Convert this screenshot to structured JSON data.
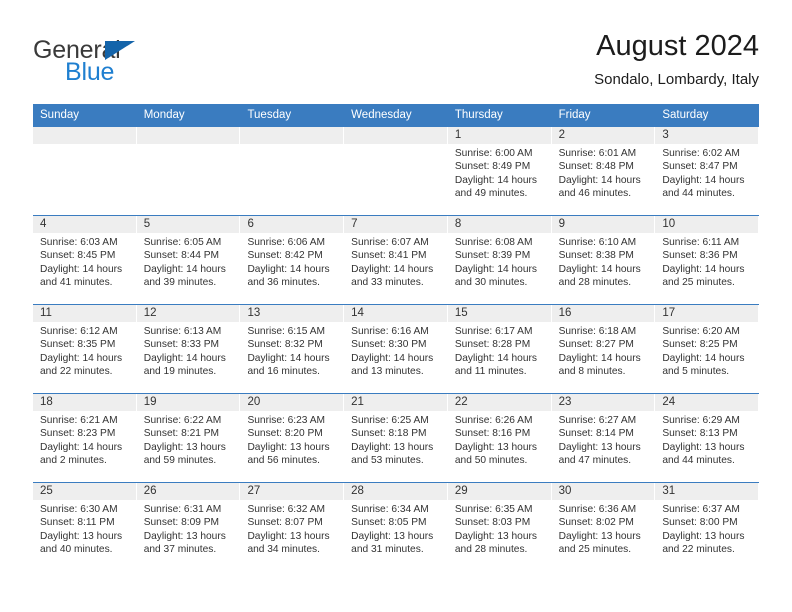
{
  "brand": {
    "name_part1": "General",
    "name_part2": "Blue",
    "triangle_color": "#1464aa",
    "blue_color": "#1f7fd0"
  },
  "header": {
    "title": "August 2024",
    "subtitle": "Sondalo, Lombardy, Italy"
  },
  "theme": {
    "header_bar_color": "#3a7cc0",
    "day_band_color": "#eeeeee",
    "text_color": "#333333"
  },
  "weekdays": [
    "Sunday",
    "Monday",
    "Tuesday",
    "Wednesday",
    "Thursday",
    "Friday",
    "Saturday"
  ],
  "labels": {
    "sunrise_prefix": "Sunrise: ",
    "sunset_prefix": "Sunset: ",
    "daylight_prefix": "Daylight: "
  },
  "weeks": [
    [
      {
        "day": "",
        "empty": true
      },
      {
        "day": "",
        "empty": true
      },
      {
        "day": "",
        "empty": true
      },
      {
        "day": "",
        "empty": true
      },
      {
        "day": "1",
        "sunrise": "Sunrise: 6:00 AM",
        "sunset": "Sunset: 8:49 PM",
        "daylight_l1": "Daylight: 14 hours",
        "daylight_l2": "and 49 minutes."
      },
      {
        "day": "2",
        "sunrise": "Sunrise: 6:01 AM",
        "sunset": "Sunset: 8:48 PM",
        "daylight_l1": "Daylight: 14 hours",
        "daylight_l2": "and 46 minutes."
      },
      {
        "day": "3",
        "sunrise": "Sunrise: 6:02 AM",
        "sunset": "Sunset: 8:47 PM",
        "daylight_l1": "Daylight: 14 hours",
        "daylight_l2": "and 44 minutes."
      }
    ],
    [
      {
        "day": "4",
        "sunrise": "Sunrise: 6:03 AM",
        "sunset": "Sunset: 8:45 PM",
        "daylight_l1": "Daylight: 14 hours",
        "daylight_l2": "and 41 minutes."
      },
      {
        "day": "5",
        "sunrise": "Sunrise: 6:05 AM",
        "sunset": "Sunset: 8:44 PM",
        "daylight_l1": "Daylight: 14 hours",
        "daylight_l2": "and 39 minutes."
      },
      {
        "day": "6",
        "sunrise": "Sunrise: 6:06 AM",
        "sunset": "Sunset: 8:42 PM",
        "daylight_l1": "Daylight: 14 hours",
        "daylight_l2": "and 36 minutes."
      },
      {
        "day": "7",
        "sunrise": "Sunrise: 6:07 AM",
        "sunset": "Sunset: 8:41 PM",
        "daylight_l1": "Daylight: 14 hours",
        "daylight_l2": "and 33 minutes."
      },
      {
        "day": "8",
        "sunrise": "Sunrise: 6:08 AM",
        "sunset": "Sunset: 8:39 PM",
        "daylight_l1": "Daylight: 14 hours",
        "daylight_l2": "and 30 minutes."
      },
      {
        "day": "9",
        "sunrise": "Sunrise: 6:10 AM",
        "sunset": "Sunset: 8:38 PM",
        "daylight_l1": "Daylight: 14 hours",
        "daylight_l2": "and 28 minutes."
      },
      {
        "day": "10",
        "sunrise": "Sunrise: 6:11 AM",
        "sunset": "Sunset: 8:36 PM",
        "daylight_l1": "Daylight: 14 hours",
        "daylight_l2": "and 25 minutes."
      }
    ],
    [
      {
        "day": "11",
        "sunrise": "Sunrise: 6:12 AM",
        "sunset": "Sunset: 8:35 PM",
        "daylight_l1": "Daylight: 14 hours",
        "daylight_l2": "and 22 minutes."
      },
      {
        "day": "12",
        "sunrise": "Sunrise: 6:13 AM",
        "sunset": "Sunset: 8:33 PM",
        "daylight_l1": "Daylight: 14 hours",
        "daylight_l2": "and 19 minutes."
      },
      {
        "day": "13",
        "sunrise": "Sunrise: 6:15 AM",
        "sunset": "Sunset: 8:32 PM",
        "daylight_l1": "Daylight: 14 hours",
        "daylight_l2": "and 16 minutes."
      },
      {
        "day": "14",
        "sunrise": "Sunrise: 6:16 AM",
        "sunset": "Sunset: 8:30 PM",
        "daylight_l1": "Daylight: 14 hours",
        "daylight_l2": "and 13 minutes."
      },
      {
        "day": "15",
        "sunrise": "Sunrise: 6:17 AM",
        "sunset": "Sunset: 8:28 PM",
        "daylight_l1": "Daylight: 14 hours",
        "daylight_l2": "and 11 minutes."
      },
      {
        "day": "16",
        "sunrise": "Sunrise: 6:18 AM",
        "sunset": "Sunset: 8:27 PM",
        "daylight_l1": "Daylight: 14 hours",
        "daylight_l2": "and 8 minutes."
      },
      {
        "day": "17",
        "sunrise": "Sunrise: 6:20 AM",
        "sunset": "Sunset: 8:25 PM",
        "daylight_l1": "Daylight: 14 hours",
        "daylight_l2": "and 5 minutes."
      }
    ],
    [
      {
        "day": "18",
        "sunrise": "Sunrise: 6:21 AM",
        "sunset": "Sunset: 8:23 PM",
        "daylight_l1": "Daylight: 14 hours",
        "daylight_l2": "and 2 minutes."
      },
      {
        "day": "19",
        "sunrise": "Sunrise: 6:22 AM",
        "sunset": "Sunset: 8:21 PM",
        "daylight_l1": "Daylight: 13 hours",
        "daylight_l2": "and 59 minutes."
      },
      {
        "day": "20",
        "sunrise": "Sunrise: 6:23 AM",
        "sunset": "Sunset: 8:20 PM",
        "daylight_l1": "Daylight: 13 hours",
        "daylight_l2": "and 56 minutes."
      },
      {
        "day": "21",
        "sunrise": "Sunrise: 6:25 AM",
        "sunset": "Sunset: 8:18 PM",
        "daylight_l1": "Daylight: 13 hours",
        "daylight_l2": "and 53 minutes."
      },
      {
        "day": "22",
        "sunrise": "Sunrise: 6:26 AM",
        "sunset": "Sunset: 8:16 PM",
        "daylight_l1": "Daylight: 13 hours",
        "daylight_l2": "and 50 minutes."
      },
      {
        "day": "23",
        "sunrise": "Sunrise: 6:27 AM",
        "sunset": "Sunset: 8:14 PM",
        "daylight_l1": "Daylight: 13 hours",
        "daylight_l2": "and 47 minutes."
      },
      {
        "day": "24",
        "sunrise": "Sunrise: 6:29 AM",
        "sunset": "Sunset: 8:13 PM",
        "daylight_l1": "Daylight: 13 hours",
        "daylight_l2": "and 44 minutes."
      }
    ],
    [
      {
        "day": "25",
        "sunrise": "Sunrise: 6:30 AM",
        "sunset": "Sunset: 8:11 PM",
        "daylight_l1": "Daylight: 13 hours",
        "daylight_l2": "and 40 minutes."
      },
      {
        "day": "26",
        "sunrise": "Sunrise: 6:31 AM",
        "sunset": "Sunset: 8:09 PM",
        "daylight_l1": "Daylight: 13 hours",
        "daylight_l2": "and 37 minutes."
      },
      {
        "day": "27",
        "sunrise": "Sunrise: 6:32 AM",
        "sunset": "Sunset: 8:07 PM",
        "daylight_l1": "Daylight: 13 hours",
        "daylight_l2": "and 34 minutes."
      },
      {
        "day": "28",
        "sunrise": "Sunrise: 6:34 AM",
        "sunset": "Sunset: 8:05 PM",
        "daylight_l1": "Daylight: 13 hours",
        "daylight_l2": "and 31 minutes."
      },
      {
        "day": "29",
        "sunrise": "Sunrise: 6:35 AM",
        "sunset": "Sunset: 8:03 PM",
        "daylight_l1": "Daylight: 13 hours",
        "daylight_l2": "and 28 minutes."
      },
      {
        "day": "30",
        "sunrise": "Sunrise: 6:36 AM",
        "sunset": "Sunset: 8:02 PM",
        "daylight_l1": "Daylight: 13 hours",
        "daylight_l2": "and 25 minutes."
      },
      {
        "day": "31",
        "sunrise": "Sunrise: 6:37 AM",
        "sunset": "Sunset: 8:00 PM",
        "daylight_l1": "Daylight: 13 hours",
        "daylight_l2": "and 22 minutes."
      }
    ]
  ]
}
